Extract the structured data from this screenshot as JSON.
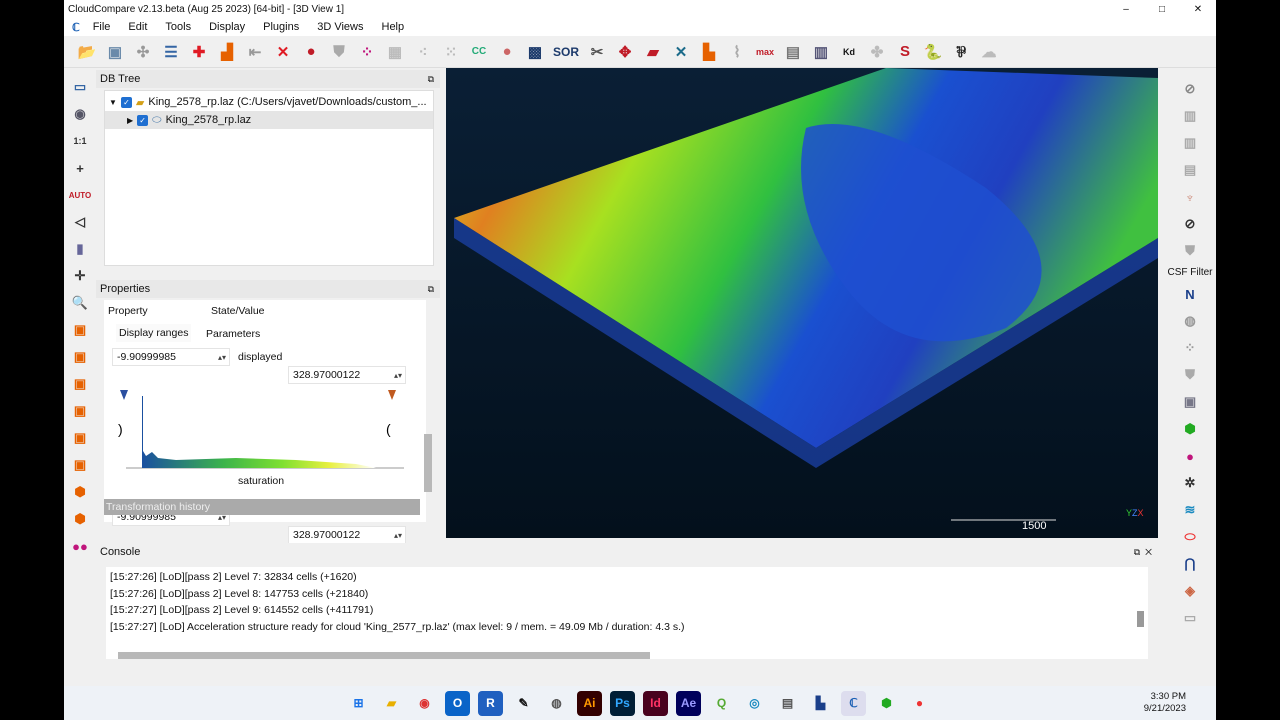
{
  "window": {
    "title": "CloudCompare v2.13.beta (Aug 25 2023) [64-bit] - [3D View 1]",
    "minimize": "–",
    "maximize": "□",
    "close": "✕"
  },
  "menu": [
    "File",
    "Edit",
    "Tools",
    "Display",
    "Plugins",
    "3D Views",
    "Help"
  ],
  "toolbar": {
    "sor_label": "SOR",
    "kd_label": "Kd"
  },
  "dbtree": {
    "title": "DB Tree",
    "root": "King_2578_rp.laz (C:/Users/vjavet/Downloads/custom_...",
    "child": "King_2578_rp.laz"
  },
  "properties": {
    "title": "Properties",
    "col_property": "Property",
    "col_value": "State/Value",
    "tab_display": "Display ranges",
    "tab_params": "Parameters",
    "displayed_min": "-9.90999985",
    "displayed_label": "displayed",
    "displayed_max": "328.97000122",
    "saturation_min": "-9.90999985",
    "saturation_label": "saturation",
    "saturation_max": "328.97000122",
    "transformation_history": "Transformation history"
  },
  "view": {
    "scale_label": "1500",
    "axis_y": "Y",
    "axis_z": "Z",
    "axis_x": "X"
  },
  "right_toolbar": {
    "csf_label": "CSF Filter",
    "n_label": "N"
  },
  "console": {
    "title": "Console",
    "lines": [
      "[15:27:26] [LoD][pass 2] Level 7: 32834 cells (+1620)",
      "[15:27:26] [LoD][pass 2] Level 8: 147753 cells (+21840)",
      "[15:27:27] [LoD][pass 2] Level 9: 614552 cells (+411791)",
      "[15:27:27] [LoD] Acceleration structure ready for cloud 'King_2577_rp.laz' (max level: 9 / mem. = 49.09 Mb / duration: 4.3 s.)"
    ]
  },
  "taskbar": {
    "time": "3:30 PM",
    "date": "9/21/2023"
  }
}
